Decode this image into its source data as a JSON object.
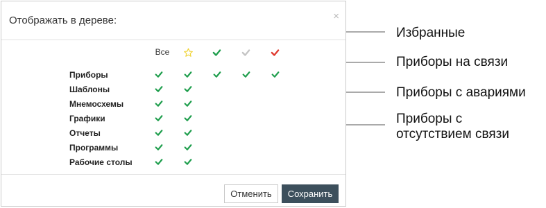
{
  "dialog": {
    "title": "Отображать в дереве:",
    "close": "×",
    "columns": {
      "all_label": "Все",
      "favorites_icon": "star-outline-icon",
      "online_icon": "green-check-icon",
      "offline_icon": "gray-check-icon",
      "alarm_icon": "red-check-icon"
    },
    "rows": [
      {
        "label": "Приборы",
        "all": true,
        "favorites": true,
        "online": true,
        "offline": true,
        "alarm": true
      },
      {
        "label": "Шаблоны",
        "all": true,
        "favorites": true
      },
      {
        "label": "Мнемосхемы",
        "all": true,
        "favorites": true
      },
      {
        "label": "Графики",
        "all": true,
        "favorites": true
      },
      {
        "label": "Отчеты",
        "all": true,
        "favorites": true
      },
      {
        "label": "Программы",
        "all": true,
        "favorites": true
      },
      {
        "label": "Рабочие столы",
        "all": true,
        "favorites": true
      }
    ],
    "buttons": {
      "cancel": "Отменить",
      "save": "Сохранить"
    }
  },
  "callouts": {
    "favorites": "Избранные",
    "online": "Приборы на связи",
    "alarm": "Приборы с авариями",
    "offline_line1": "Приборы с",
    "offline_line2": "отсутствием связи"
  },
  "colors": {
    "check_green": "#1f9e4d",
    "check_gray": "#c4c4c4",
    "check_red": "#e03a2f",
    "star_yellow": "#f0d43a",
    "save_button": "#3c4f5c"
  }
}
